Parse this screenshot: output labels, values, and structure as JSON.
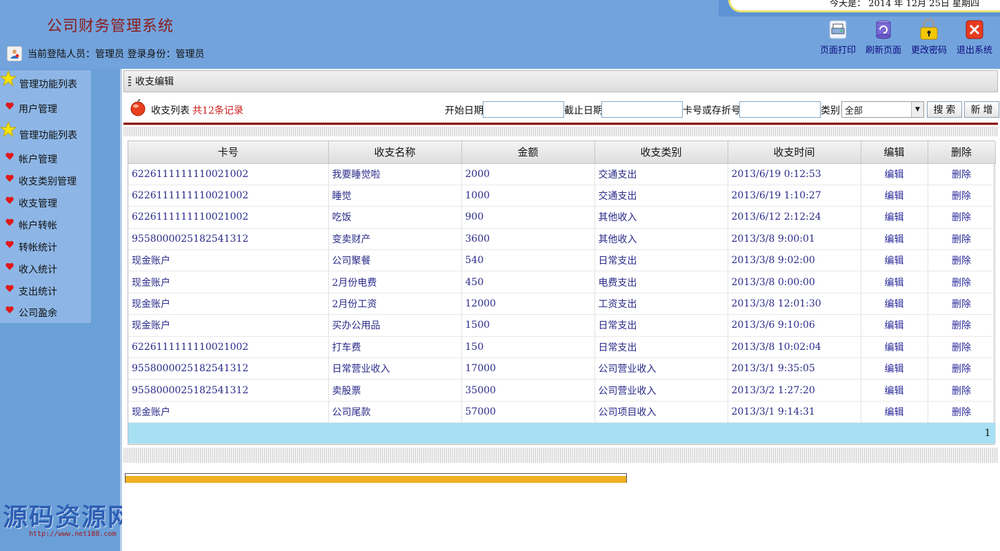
{
  "header": {
    "app_title": "公司财务管理系统",
    "user_line": "当前登陆人员：管理员 登录身份：管理员",
    "date_text": "今天是：  2014 年 12月 25日 星期四",
    "toolbar": [
      {
        "label": "页面打印",
        "icon": "print-icon",
        "color": "#4a8ad0"
      },
      {
        "label": "刷新页面",
        "icon": "refresh-icon",
        "color": "#6a6ad0"
      },
      {
        "label": "更改密码",
        "icon": "lock-icon",
        "color": "#f0c000"
      },
      {
        "label": "退出系统",
        "icon": "exit-icon",
        "color": "#e03020"
      }
    ]
  },
  "sidebar": {
    "groups": [
      {
        "title": "管理功能列表",
        "items": [
          "用户管理"
        ]
      },
      {
        "title": "管理功能列表",
        "items": [
          "帐户管理",
          "收支类别管理",
          "收支管理",
          "帐户转帐",
          "转帐统计",
          "收入统计",
          "支出统计",
          "公司盈余"
        ]
      }
    ]
  },
  "watermark": {
    "big": "源码资源网",
    "small": "http://www.net188.com"
  },
  "main": {
    "section_title": "收支编辑",
    "list_title": "收支列表",
    "record_count": "共12条记录",
    "filters": {
      "start_date_label": "开始日期",
      "end_date_label": "截止日期",
      "card_label": "卡号或存折号",
      "category_label": "类别",
      "category_value": "全部",
      "search_button": "搜索",
      "add_button": "新增"
    },
    "table": {
      "columns": [
        "卡号",
        "收支名称",
        "金额",
        "收支类别",
        "收支时间",
        "编辑",
        "删除"
      ],
      "rows": [
        [
          "6226111111110021002",
          "我要睡觉啦",
          "2000",
          "交通支出",
          "2013/6/19 0:12:53",
          "编辑",
          "删除"
        ],
        [
          "6226111111110021002",
          "睡觉",
          "1000",
          "交通支出",
          "2013/6/19 1:10:27",
          "编辑",
          "删除"
        ],
        [
          "6226111111110021002",
          "吃饭",
          "900",
          "其他收入",
          "2013/6/12 2:12:24",
          "编辑",
          "删除"
        ],
        [
          "9558000025182541312",
          "变卖财产",
          "3600",
          "其他收入",
          "2013/3/8 9:00:01",
          "编辑",
          "删除"
        ],
        [
          "现金账户",
          "公司聚餐",
          "540",
          "日常支出",
          "2013/3/8 9:02:00",
          "编辑",
          "删除"
        ],
        [
          "现金账户",
          "2月份电费",
          "450",
          "电费支出",
          "2013/3/8 0:00:00",
          "编辑",
          "删除"
        ],
        [
          "现金账户",
          "2月份工资",
          "12000",
          "工资支出",
          "2013/3/8 12:01:30",
          "编辑",
          "删除"
        ],
        [
          "现金账户",
          "买办公用品",
          "1500",
          "日常支出",
          "2013/3/6 9:10:06",
          "编辑",
          "删除"
        ],
        [
          "6226111111110021002",
          "打车费",
          "150",
          "日常支出",
          "2013/3/8 10:02:04",
          "编辑",
          "删除"
        ],
        [
          "9558000025182541312",
          "日常营业收入",
          "17000",
          "公司营业收入",
          "2013/3/1 9:35:05",
          "编辑",
          "删除"
        ],
        [
          "9558000025182541312",
          "卖股票",
          "35000",
          "公司营业收入",
          "2013/3/2 1:27:20",
          "编辑",
          "删除"
        ],
        [
          "现金账户",
          "公司尾款",
          "57000",
          "公司项目收入",
          "2013/3/1 9:14:31",
          "编辑",
          "删除"
        ]
      ],
      "page": "1"
    }
  }
}
